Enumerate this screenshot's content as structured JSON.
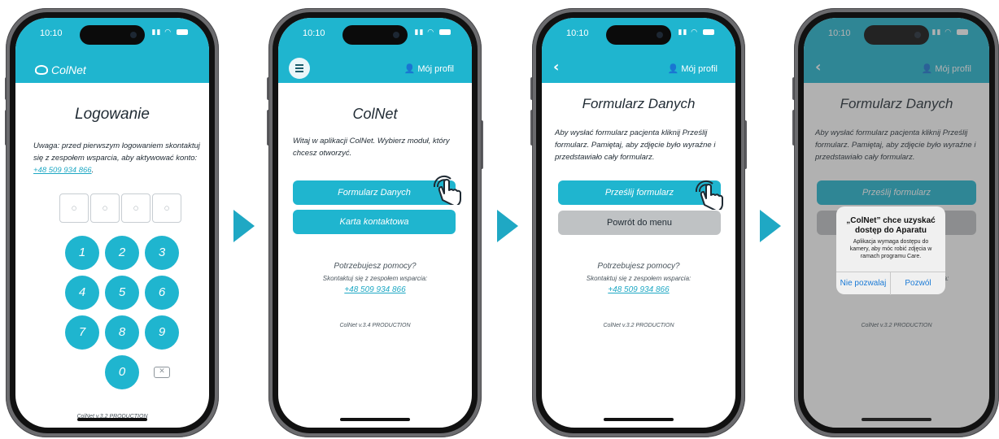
{
  "status_time": "10:10",
  "screen1": {
    "app_title": "ColNet",
    "heading": "Logowanie",
    "notice": "Uwaga: przed pierwszym logowaniem skontaktuj się z zespołem wsparcia, aby aktywować konto:",
    "support_phone": "+48 509 934 866",
    "pin_placeholder": "○",
    "keys": [
      "1",
      "2",
      "3",
      "4",
      "5",
      "6",
      "7",
      "8",
      "9",
      "0"
    ],
    "backspace_symbol": "✕",
    "version": "ColNet v.3.2 PRODUCTION"
  },
  "screen2": {
    "profile_label": "Mój profil",
    "heading": "ColNet",
    "welcome": "Witaj w aplikacji ColNet. Wybierz moduł, który chcesz otworzyć.",
    "buttons": [
      "Formularz Danych",
      "Karta kontaktowa"
    ],
    "help_question": "Potrzebujesz pomocy?",
    "help_sub": "Skontaktuj się z zespołem wsparcia:",
    "help_phone": "+48 509 934 866",
    "version": "ColNet v.3.4 PRODUCTION"
  },
  "screen3": {
    "back_symbol": "‹",
    "profile_label": "Mój profil",
    "heading": "Formularz Danych",
    "instructions": "Aby wysłać formularz pacjenta kliknij Prześlij formularz. Pamiętaj, aby zdjęcie było wyraźne i przedstawiało cały formularz.",
    "send_button": "Prześlij formularz",
    "back_button": "Powrót do menu",
    "help_question": "Potrzebujesz pomocy?",
    "help_sub": "Skontaktuj się z zespołem wsparcia:",
    "help_phone": "+48 509 934 866",
    "version": "ColNet v.3.2 PRODUCTION"
  },
  "screen4": {
    "back_symbol": "‹",
    "profile_label": "Mój profil",
    "heading": "Formularz Danych",
    "instructions": "Aby wysłać formularz pacjenta kliknij Prześlij formularz. Pamiętaj, aby zdjęcie było wyraźne i przedstawiało cały formularz.",
    "send_button": "Prześlij formularz",
    "help_sub": "Skontaktuj się z zespołem wsparcia:",
    "help_phone": "+48 509 934 866",
    "version": "ColNet v.3.2 PRODUCTION",
    "alert_title": "„ColNet” chce uzyskać dostęp do Aparatu",
    "alert_message": "Aplikacja wymaga dostępu do kamery, aby móc robić zdjęcia w ramach programu Care.",
    "alert_deny": "Nie pozwalaj",
    "alert_allow": "Pozwól"
  },
  "colors": {
    "brand": "#1fb5cf",
    "link": "#1fa8c4",
    "arrow": "#1fa8c4",
    "secondary_button": "#bfc2c4"
  }
}
